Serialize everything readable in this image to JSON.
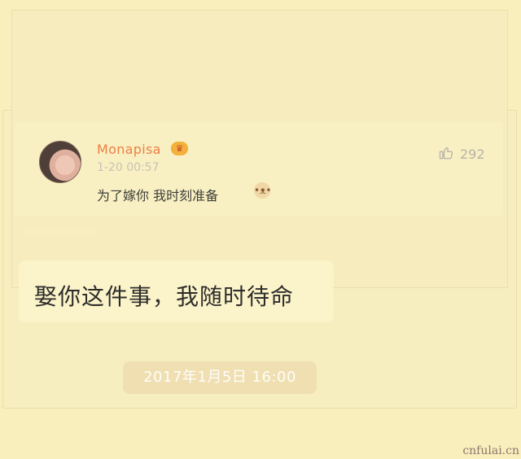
{
  "post": {
    "username": "Monapisa",
    "badge_icon": "crown-badge-icon",
    "timestamp": "1-20 00:57",
    "comment": "为了嫁你 我时刻准备",
    "comment_emoji": "cat-face-emoji",
    "like_count": "292",
    "like_icon": "thumbs-up-outline-icon"
  },
  "chat": {
    "message": "娶你这件事，我随时待命",
    "time": "2017年1月5日 16:00"
  },
  "watermark": "cnfulai.cn",
  "colors": {
    "background": "#f8efbd",
    "username": "#ee7f45",
    "text": "#3d3d3a",
    "muted": "#b8b3aa",
    "bubble": "#fbf3c9"
  }
}
